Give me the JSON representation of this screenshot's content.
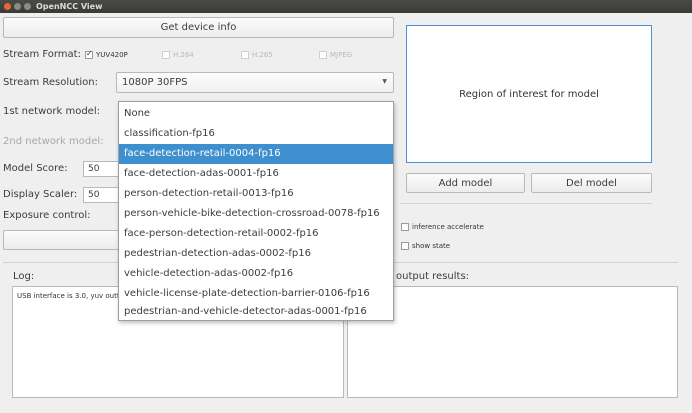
{
  "window": {
    "title": "OpenNCC View"
  },
  "buttons": {
    "get_device_info": "Get device info",
    "add_model": "Add model",
    "del_model": "Del model"
  },
  "stream_format": {
    "label": "Stream Format:",
    "options": [
      {
        "label": "YUV420P",
        "checked": true,
        "enabled": true
      },
      {
        "label": "H.264",
        "checked": false,
        "enabled": false
      },
      {
        "label": "H.265",
        "checked": false,
        "enabled": false
      },
      {
        "label": "MJPEG",
        "checked": false,
        "enabled": false
      }
    ]
  },
  "stream_resolution": {
    "label": "Stream Resolution:",
    "value": "1080P 30FPS"
  },
  "network1": {
    "label": "1st network model:"
  },
  "network2": {
    "label": "2nd network model:"
  },
  "model_score": {
    "label": "Model Score:",
    "value": "50"
  },
  "display_scaler": {
    "label": "Display Scaler:",
    "value": "50"
  },
  "exposure": {
    "label": "Exposure control:"
  },
  "roi": {
    "text": "Region of interest for model"
  },
  "options": {
    "inference_accelerate": "inference accelerate",
    "show_state": "show state"
  },
  "log": {
    "label": "Log:",
    "text": "USB interface is 3.0, yuv outf"
  },
  "output": {
    "label": "output results:"
  },
  "dropdown": {
    "selected_index": 2,
    "items": [
      "None",
      "classification-fp16",
      "face-detection-retail-0004-fp16",
      "face-detection-adas-0001-fp16",
      "person-detection-retail-0013-fp16",
      "person-vehicle-bike-detection-crossroad-0078-fp16",
      "face-person-detection-retail-0002-fp16",
      "pedestrian-detection-adas-0002-fp16",
      "vehicle-detection-adas-0002-fp16",
      "vehicle-license-plate-detection-barrier-0106-fp16",
      "pedestrian-and-vehicle-detector-adas-0001-fp16"
    ]
  }
}
